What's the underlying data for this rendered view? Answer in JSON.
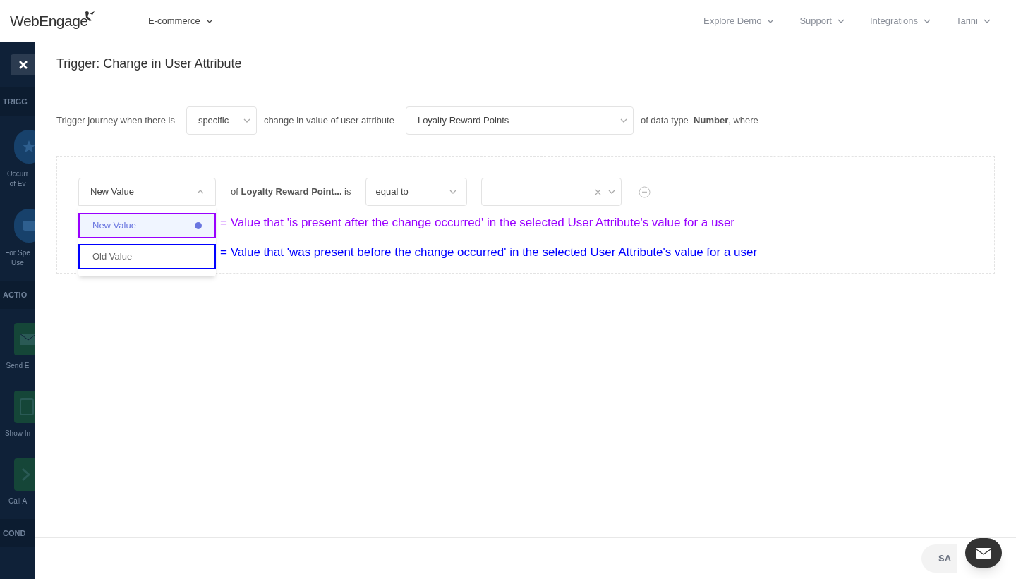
{
  "header": {
    "logo": "WebEngage",
    "project": "E-commerce",
    "nav": [
      "Explore Demo",
      "Support",
      "Integrations",
      "Tarini"
    ]
  },
  "sidebar": {
    "sections": [
      {
        "heading": "TRIGG",
        "items": [
          {
            "kind": "star",
            "label": [
              "Occurr",
              "of Ev"
            ]
          },
          {
            "kind": "csv",
            "label": [
              "For Spe",
              "Use"
            ]
          }
        ]
      },
      {
        "heading": "ACTIO",
        "items": [
          {
            "kind": "mail",
            "label": [
              "Send E"
            ]
          },
          {
            "kind": "screen",
            "label": [
              "Show In"
            ]
          },
          {
            "kind": "chevron",
            "label": [
              "Call A"
            ]
          }
        ]
      },
      {
        "heading": "COND"
      }
    ]
  },
  "dialog": {
    "title": "Trigger: Change in User Attribute",
    "trigger": [
      {
        "kind": "text",
        "text": "Trigger journey when there is"
      },
      {
        "kind": "select",
        "value": "specific"
      },
      {
        "kind": "text",
        "text": "change in value of user attribute"
      },
      {
        "kind": "attribute_select",
        "value": "Loyalty Reward Points"
      },
      {
        "kind": "text",
        "text": "of data type  **Number**, where"
      }
    ],
    "condition": {
      "value_select": {
        "value": "New Value",
        "expanded": true,
        "options": [
          {
            "label": "New Value",
            "selected": true,
            "color": "#9900ff",
            "note": "= Value that 'is present after the change occurred' in the selected User Attribute's value for a user"
          },
          {
            "label": "Old Value",
            "selected": false,
            "color": "#0000ff",
            "note": "= Value that 'was present before the change occurred' in the selected User Attribute's value for a user"
          }
        ]
      },
      "attribute_text": "of **Loyalty Reward Point...** is",
      "operator": "equal to"
    },
    "save_button": "SA"
  }
}
